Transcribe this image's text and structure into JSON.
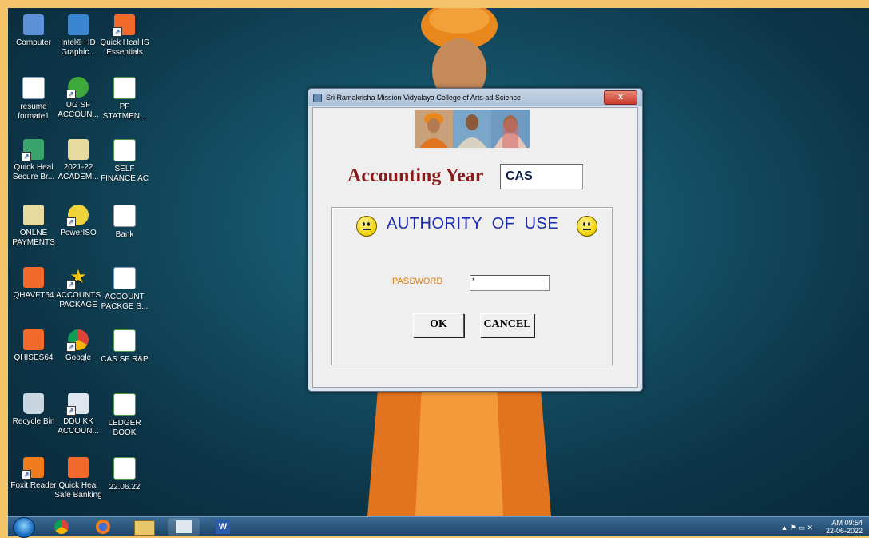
{
  "desktop": {
    "icons": [
      {
        "label": "Computer",
        "icon": "computer-icon",
        "color": "#5b8fd6"
      },
      {
        "label": "Intel® HD Graphic...",
        "icon": "intel-graphics-icon",
        "color": "#3a86d1"
      },
      {
        "label": "Quick Heal IS Essentials",
        "icon": "quick-heal-icon",
        "color": "#f26a2b"
      },
      {
        "label": "resume formate1",
        "icon": "word-document-icon",
        "color": "#ffffff"
      },
      {
        "label": "UG SF ACCOUN...",
        "icon": "tree-shortcut-icon",
        "color": "#3fa83a"
      },
      {
        "label": "PF STATMEN...",
        "icon": "excel-document-icon",
        "color": "#ffffff"
      },
      {
        "label": "Quick Heal Secure Br...",
        "icon": "secure-browser-icon",
        "color": "#3aa36b"
      },
      {
        "label": "2021-22 ACADEM...",
        "icon": "folder-icon",
        "color": "#e8d9a0"
      },
      {
        "label": "SELF FINANCE AC",
        "icon": "excel-document-icon",
        "color": "#ffffff"
      },
      {
        "label": "ONLNE PAYMENTS",
        "icon": "folder-icon",
        "color": "#e8d9a0"
      },
      {
        "label": "PowerISO",
        "icon": "poweriso-icon",
        "color": "#f0d23a"
      },
      {
        "label": "Bank",
        "icon": "document-icon",
        "color": "#ffffff"
      },
      {
        "label": "QHAVFT64",
        "icon": "quick-heal-icon",
        "color": "#f26a2b"
      },
      {
        "label": "ACCOUNTS PACKAGE",
        "icon": "star-shortcut-icon",
        "color": "#f5c518"
      },
      {
        "label": "ACCOUNT PACKGE S...",
        "icon": "word-document-icon",
        "color": "#ffffff"
      },
      {
        "label": "QHISES64",
        "icon": "quick-heal-icon",
        "color": "#f26a2b"
      },
      {
        "label": "Google",
        "icon": "chrome-icon",
        "color": "#3b7de0"
      },
      {
        "label": "CAS SF R&P",
        "icon": "excel-document-icon",
        "color": "#ffffff"
      },
      {
        "label": "Recycle Bin",
        "icon": "recycle-bin-icon",
        "color": "#c9d6e2"
      },
      {
        "label": "DDU KK ACCOUN...",
        "icon": "shortcut-icon",
        "color": "#dfe6ee"
      },
      {
        "label": "LEDGER BOOK",
        "icon": "excel-document-icon",
        "color": "#ffffff"
      },
      {
        "label": "Foxit Reader",
        "icon": "foxit-reader-icon",
        "color": "#f07c1e"
      },
      {
        "label": "Quick Heal Safe Banking",
        "icon": "safe-banking-icon",
        "color": "#f26a2b"
      },
      {
        "label": "22.06.22",
        "icon": "excel-document-icon",
        "color": "#ffffff"
      }
    ]
  },
  "dialog": {
    "title": "Sri Ramakrisha Mission Vidyalaya College of Arts ad Science",
    "close_label": "x",
    "accounting_year_label": "Accounting Year",
    "accounting_year_value": "CAS",
    "authority_title": "AUTHORITY OF  USE",
    "password_label": "PASSWORD",
    "password_value": "*",
    "ok_label": "OK",
    "cancel_label": "CANCEL"
  },
  "taskbar": {
    "apps": [
      "start-orb",
      "chrome-icon",
      "firefox-icon",
      "explorer-icon",
      "accounting-app-icon",
      "word-icon"
    ],
    "time": "AM 09:54",
    "date": "22-06-2022"
  },
  "colors": {
    "frame": "#f3c46a",
    "accounting_label": "#8b1a1a",
    "authority_title": "#1a2bb0",
    "password_label": "#e07a10"
  }
}
